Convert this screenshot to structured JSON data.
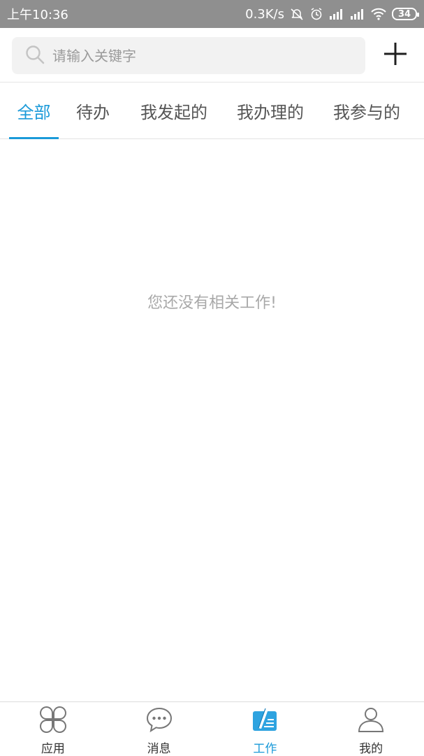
{
  "status_bar": {
    "time": "上午10:36",
    "network_speed": "0.3K/s",
    "battery_level": "34",
    "icons": [
      "mute-bell-icon",
      "alarm-icon",
      "signal-icon",
      "signal-icon",
      "wifi-icon",
      "battery-icon"
    ]
  },
  "search": {
    "placeholder": "请输入关键字",
    "value": ""
  },
  "tabs": [
    {
      "label": "全部",
      "active": true
    },
    {
      "label": "待办",
      "active": false
    },
    {
      "label": "我发起的",
      "active": false
    },
    {
      "label": "我办理的",
      "active": false
    },
    {
      "label": "我参与的",
      "active": false
    }
  ],
  "empty_message": "您还没有相关工作!",
  "bottom_nav": [
    {
      "label": "应用",
      "icon": "clover-apps-icon",
      "active": false
    },
    {
      "label": "消息",
      "icon": "chat-bubble-icon",
      "active": false
    },
    {
      "label": "工作",
      "icon": "work-pen-icon",
      "active": true
    },
    {
      "label": "我的",
      "icon": "user-icon",
      "active": false
    }
  ],
  "colors": {
    "accent": "#1a9ad9",
    "status_bar_bg": "#8f8f8f",
    "text_muted": "#a8a8a8"
  }
}
